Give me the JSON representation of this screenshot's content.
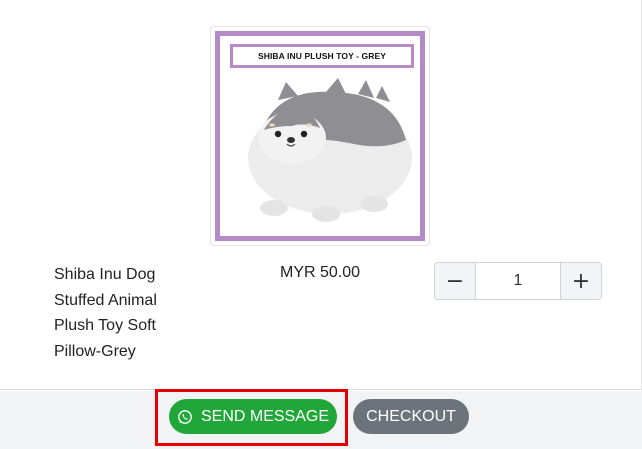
{
  "product": {
    "image_banner_text": "SHIBA INU PLUSH TOY - GREY",
    "image_alt": "Shiba Inu plush toy grey",
    "name_lines": [
      "Shiba Inu Dog",
      "Stuffed Animal",
      "Plush Toy Soft",
      "Pillow-Grey"
    ],
    "price": "MYR 50.00"
  },
  "quantity": {
    "decrement_label": "−",
    "value": "1",
    "increment_label": "+"
  },
  "actions": {
    "send_message_label": "SEND MESSAGE",
    "send_message_icon": "whatsapp-icon",
    "checkout_label": "CHECKOUT"
  },
  "colors": {
    "send_message_bg": "#21a63a",
    "checkout_bg": "#6c737b",
    "highlight_border": "#e60000",
    "image_frame": "#b58ac7"
  }
}
